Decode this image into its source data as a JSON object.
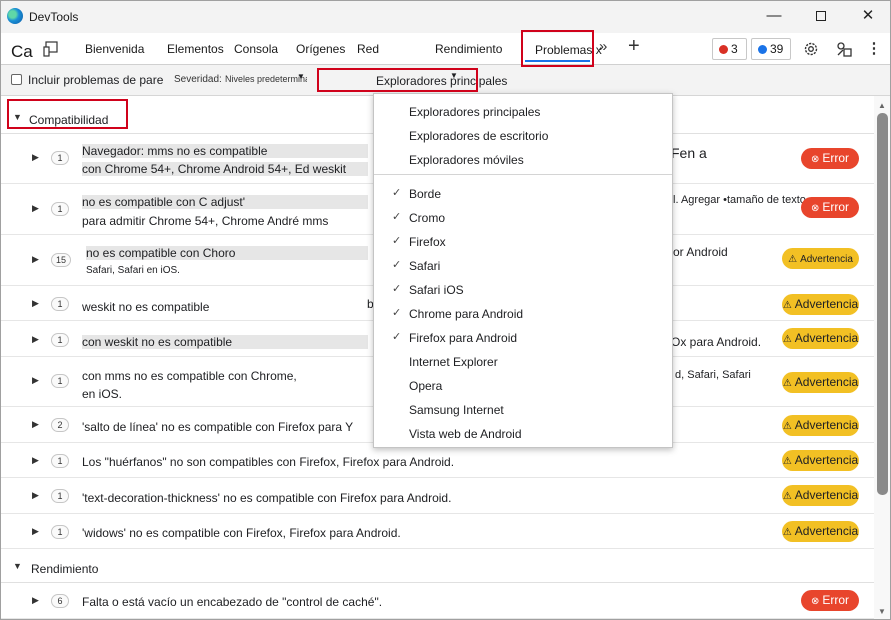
{
  "window": {
    "title": "DevTools",
    "minimize_glyph": "—",
    "close_glyph": "✕"
  },
  "toolbar": {
    "ca_label": "Ca",
    "tabs": [
      {
        "label": "Bienvenida"
      },
      {
        "label": "Elementos"
      },
      {
        "label": "Consola"
      },
      {
        "label": "Orígenes"
      },
      {
        "label": "Red"
      },
      {
        "label": "Rendimiento"
      },
      {
        "label": "Problemas x"
      }
    ],
    "more_glyph": "»",
    "add_glyph": "+",
    "error_count": "3",
    "issue_count": "39",
    "settings_icon": "gear-icon",
    "customize_icon": "customize-icon",
    "more_icon": "kebab-icon"
  },
  "filterbar": {
    "include_label": "Incluir problemas de pare",
    "severity_label": "Severidad:",
    "levels_value": "Niveles predeterminados",
    "browsers_value": "Exploradores principales"
  },
  "sections": {
    "compat_title": "Compatibilidad",
    "perf_title": "Rendimiento"
  },
  "rows": [
    {
      "count": "1",
      "line1": "Navegador: mms no es compatible",
      "line2": "con Chrome 54+, Chrome Android 54+, Ed weskit",
      "extra": "Fen a",
      "badge": "Error"
    },
    {
      "count": "1",
      "line1": "no es compatible con C adjust'",
      "line2": "para admitir Chrome 54+, Chrome André mms",
      "extra": "l. Agregar •tamaño de texto-",
      "badge": "Error"
    },
    {
      "count": "15",
      "line1": "no es compatible con Choro",
      "line2": "Safari, Safari en iOS.",
      "extra": "or Android",
      "badge": "Advertencia"
    },
    {
      "count": "1",
      "line1": "weskit no es compatible",
      "extra": "b",
      "badge": "Advertencia"
    },
    {
      "count": "1",
      "line1": "con weskit no es compatible",
      "extra": "Ox para Android.",
      "badge": "Advertencia"
    },
    {
      "count": "1",
      "line1": "con mms no es compatible con Chrome,",
      "line2": "en iOS.",
      "extra": "d, Safari, Safari",
      "badge": "Advertencia"
    },
    {
      "count": "2",
      "line1": "'salto de línea' no es compatible con Firefox para Y",
      "badge": "Advertencia"
    },
    {
      "count": "1",
      "line1": "Los \"huérfanos\" no son compatibles con Firefox, Firefox para Android.",
      "badge": "Advertencia"
    },
    {
      "count": "1",
      "line1": "'text-decoration-thickness' no es compatible con Firefox para Android.",
      "badge": "Advertencia"
    },
    {
      "count": "1",
      "line1": "'widows' no es compatible con Firefox, Firefox para Android.",
      "badge": "Advertencia"
    },
    {
      "count": "6",
      "line1": "Falta o está vacío un encabezado de \"control de caché\".",
      "badge": "Error"
    }
  ],
  "dropdown": {
    "presets": [
      "Exploradores principales",
      "Exploradores de escritorio",
      "Exploradores móviles"
    ],
    "browsers": [
      {
        "label": "Borde",
        "checked": true
      },
      {
        "label": "Cromo",
        "checked": true
      },
      {
        "label": "Firefox",
        "checked": true
      },
      {
        "label": "Safari",
        "checked": true
      },
      {
        "label": "Safari iOS",
        "checked": true
      },
      {
        "label": "Chrome para Android",
        "checked": true
      },
      {
        "label": "Firefox para Android",
        "checked": true
      },
      {
        "label": "Internet Explorer",
        "checked": false
      },
      {
        "label": "Opera",
        "checked": false
      },
      {
        "label": "Samsung Internet",
        "checked": false
      },
      {
        "label": "Vista web de Android",
        "checked": false
      }
    ],
    "check_glyph": "✓"
  },
  "colors": {
    "error": "#e8452c",
    "warning": "#f2c024",
    "accent": "#1a73e8",
    "highlight_box": "#d0021b"
  }
}
